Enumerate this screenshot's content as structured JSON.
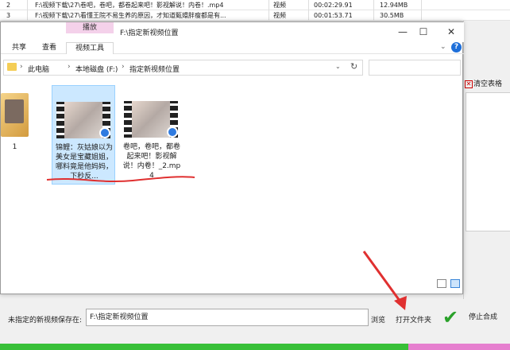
{
  "background_table": {
    "rows": [
      {
        "num": "2",
        "path": "F:\\视频下载\\27\\卷吧，卷吧，都卷起来吧！影视解说！内卷！.mp4",
        "type": "视频",
        "duration": "00:02:29.91",
        "size": "12.94MB"
      },
      {
        "num": "3",
        "path": "F:\\视频下载\\27\\看懂王院不易生养的原因，才知道甄嬛胖瘦都是有...",
        "type": "视频",
        "duration": "00:01:53.71",
        "size": "30.5MB"
      }
    ]
  },
  "right_panel": {
    "clear_label": "清空表格"
  },
  "explorer": {
    "manage_tab": "播放",
    "window_title": "F:\\指定新视频位置",
    "tabs": {
      "share": "共享",
      "view": "查看",
      "video_tools": "视频工具"
    },
    "breadcrumbs": [
      "此电脑",
      "本地磁盘 (F:)",
      "指定新视频位置"
    ],
    "items": [
      {
        "label": "1"
      },
      {
        "label": "锦鲤：灰姑娘以为美女是宝藏姐姐，哪料竟是他妈妈，下秒反..."
      },
      {
        "label": "卷吧，卷吧，都卷起来吧！影视解说！内卷！_2.mp4"
      }
    ]
  },
  "bottom": {
    "save_label": "未指定的新视频保存在:",
    "save_path": "F:\\指定新视频位置",
    "browse_label": "浏览",
    "open_folder_label": "打开文件夹",
    "stop_label": "停止合成",
    "progress_fraction": 0.8
  },
  "colors": {
    "accent": "#2f7be0",
    "progress": "#38c038",
    "arrow": "#e03030",
    "manage_tab": "#f4d1ea"
  }
}
